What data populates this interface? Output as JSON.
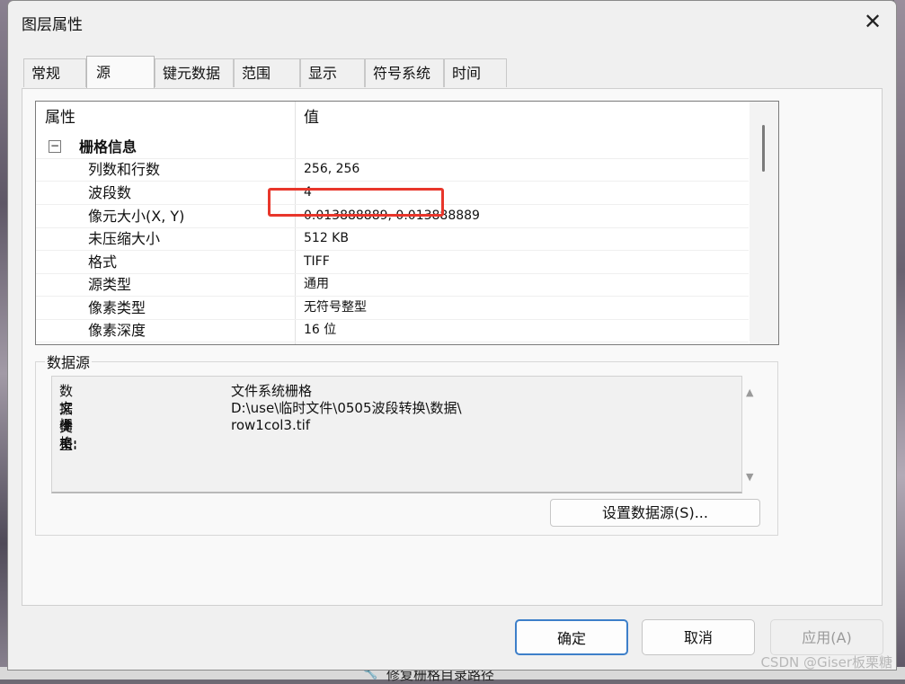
{
  "background": {
    "underlying_text": "修复栅格目录路径",
    "watermark": "CSDN @Giser板栗糖"
  },
  "dialog": {
    "title": "图层属性",
    "close_glyph": "✕"
  },
  "tabs": [
    {
      "label": "常规",
      "active": false
    },
    {
      "label": "源",
      "active": true
    },
    {
      "label": "键元数据",
      "active": false
    },
    {
      "label": "范围",
      "active": false
    },
    {
      "label": "显示",
      "active": false
    },
    {
      "label": "符号系统",
      "active": false
    },
    {
      "label": "时间",
      "active": false
    }
  ],
  "property_grid": {
    "headers": {
      "property": "属性",
      "value": "值"
    },
    "category": {
      "toggle": "−",
      "label": "栅格信息"
    },
    "rows": [
      {
        "property": "列数和行数",
        "value": "256, 256"
      },
      {
        "property": "波段数",
        "value": "4"
      },
      {
        "property": "像元大小(X, Y)",
        "value": "0.013888889, 0.013888889"
      },
      {
        "property": "未压缩大小",
        "value": "512 KB"
      },
      {
        "property": "格式",
        "value": "TIFF"
      },
      {
        "property": "源类型",
        "value": "通用"
      },
      {
        "property": "像素类型",
        "value": "无符号整型"
      },
      {
        "property": "像素深度",
        "value": "16 位"
      }
    ],
    "highlight_color": "#e8362b"
  },
  "data_source": {
    "group_label": "数据源",
    "rows": [
      {
        "key": "数据类型:",
        "value": "文件系统栅格"
      },
      {
        "key": "文件夹:",
        "value": "D:\\use\\临时文件\\0505波段转换\\数据\\"
      },
      {
        "key": "栅格:",
        "value": "row1col3.tif"
      }
    ],
    "set_source_button": "设置数据源(S)..."
  },
  "buttons": {
    "ok": "确定",
    "cancel": "取消",
    "apply": "应用(A)"
  },
  "colors": {
    "accent": "#3d7fc9",
    "dialog_bg": "#f0f0f0"
  }
}
